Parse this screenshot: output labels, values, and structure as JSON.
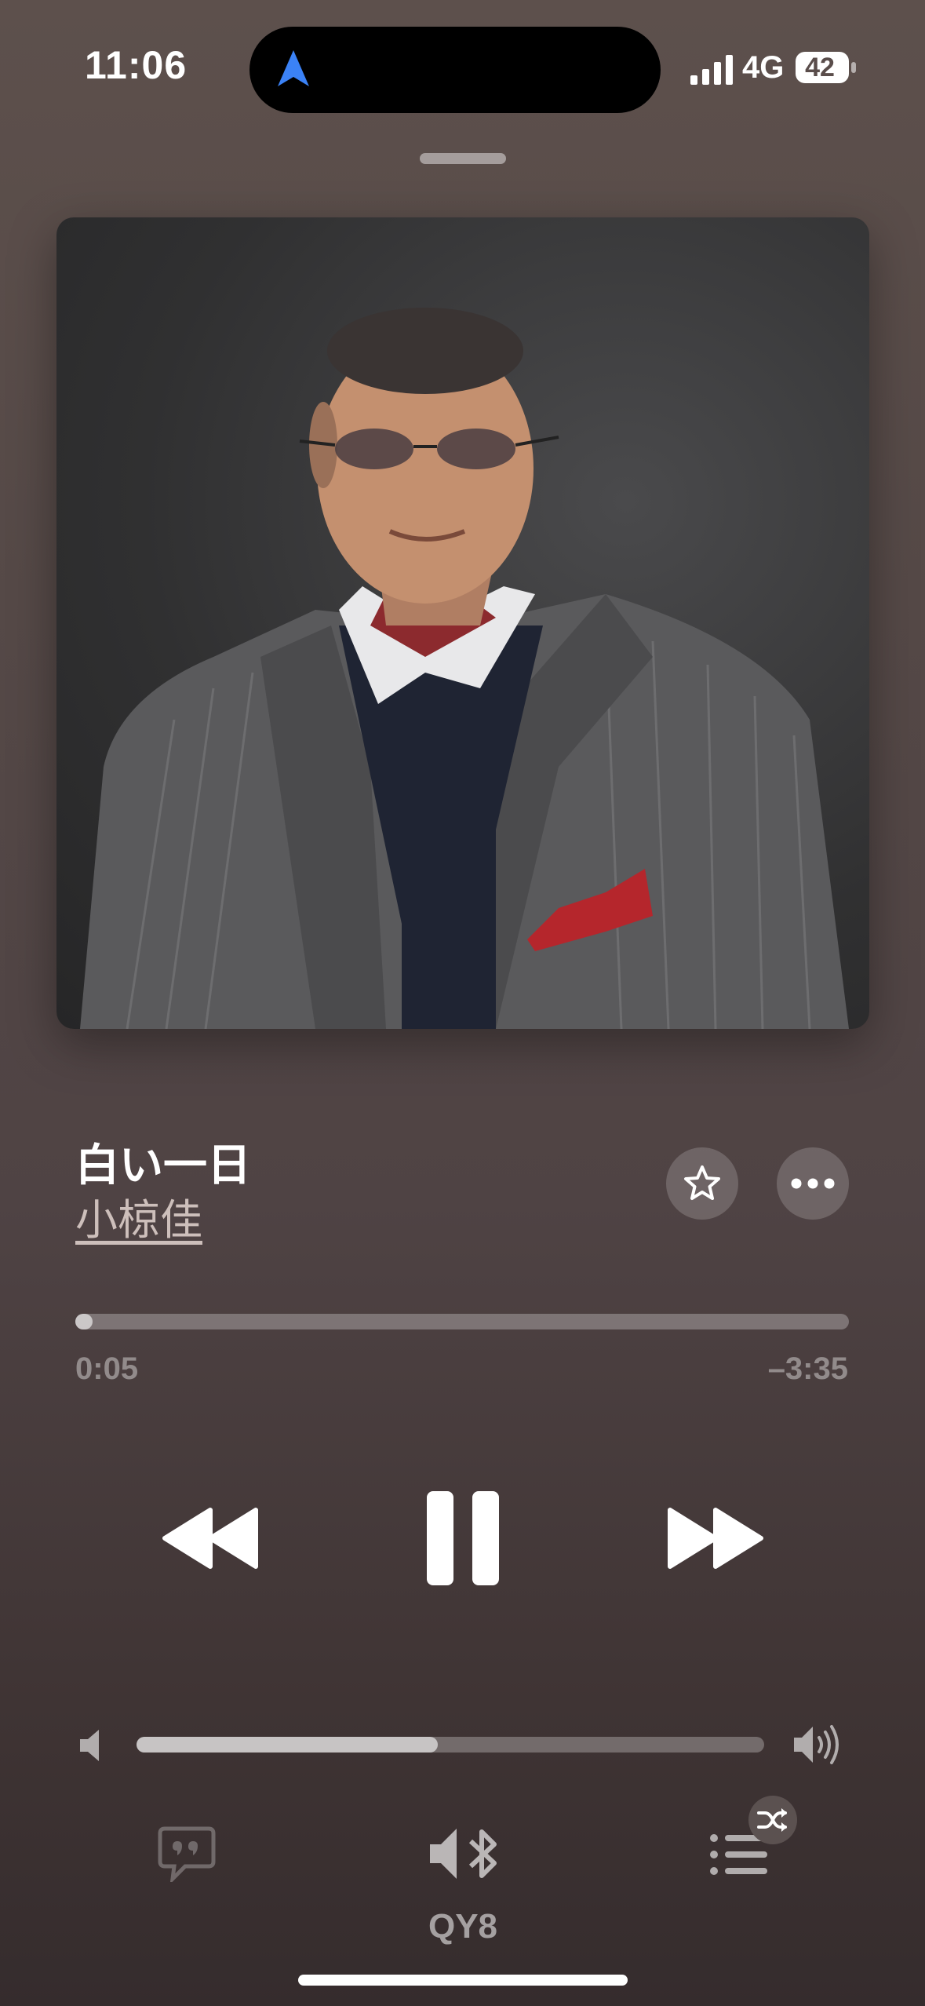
{
  "status_bar": {
    "time": "11:06",
    "network": "4G",
    "battery": "42",
    "location_icon": "navigation-arrow-icon"
  },
  "now_playing": {
    "title": "白い一日",
    "artist": "小椋佳",
    "elapsed": "0:05",
    "remaining": "–3:35",
    "progress_fraction": 0.022,
    "volume_fraction": 0.48
  },
  "output_device": "QY8",
  "colors": {
    "accent_location": "#3b82f6",
    "background_top": "#5d504c",
    "background_bottom": "#352c2d"
  },
  "icons": {
    "favorite": "star-icon",
    "more": "ellipsis-icon",
    "rewind": "rewind-icon",
    "pause": "pause-icon",
    "forward": "fast-forward-icon",
    "volume_low": "speaker-low-icon",
    "volume_high": "speaker-high-icon",
    "lyrics": "lyrics-bubble-icon",
    "airplay": "bluetooth-speaker-icon",
    "queue": "list-icon",
    "shuffle": "shuffle-icon"
  }
}
